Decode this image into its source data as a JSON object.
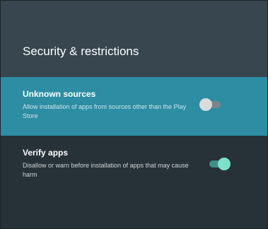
{
  "colors": {
    "background": "#263238",
    "header": "#37464f",
    "selected_row": "#2c8da3",
    "switch_on": "#7ee0c9",
    "switch_off": "#d9dcdd"
  },
  "page": {
    "title": "Security & restrictions"
  },
  "settings": [
    {
      "title": "Unknown sources",
      "description": "Allow installation of apps from sources other than the Play Store",
      "enabled": false,
      "selected": true
    },
    {
      "title": "Verify apps",
      "description": "Disallow or warn before installation of apps that may cause harm",
      "enabled": true,
      "selected": false
    }
  ]
}
